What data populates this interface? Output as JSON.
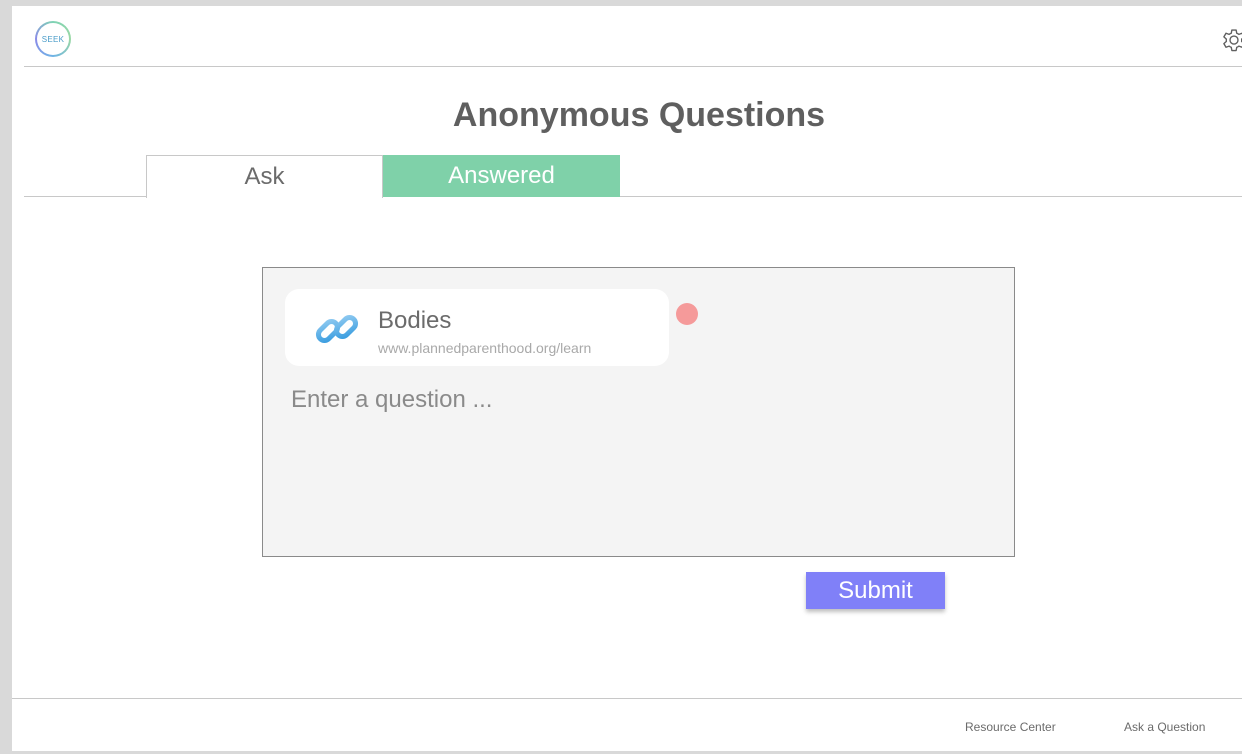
{
  "header": {
    "logo_text": "SEEK",
    "settings_icon": "gear-icon"
  },
  "page": {
    "title": "Anonymous Questions"
  },
  "tabs": [
    {
      "label": "Ask",
      "active": true
    },
    {
      "label": "Answered",
      "active": false,
      "color": "#7fd1a9"
    }
  ],
  "question_box": {
    "attachment": {
      "icon": "link-icon",
      "title": "Bodies",
      "url": "www.plannedparenthood.org/learn",
      "remove_color": "#f59a9a"
    },
    "placeholder": "Enter a question ..."
  },
  "submit": {
    "label": "Submit",
    "color": "#8080f8"
  },
  "footer": {
    "links": [
      "Resource Center",
      "Ask a Question"
    ]
  }
}
